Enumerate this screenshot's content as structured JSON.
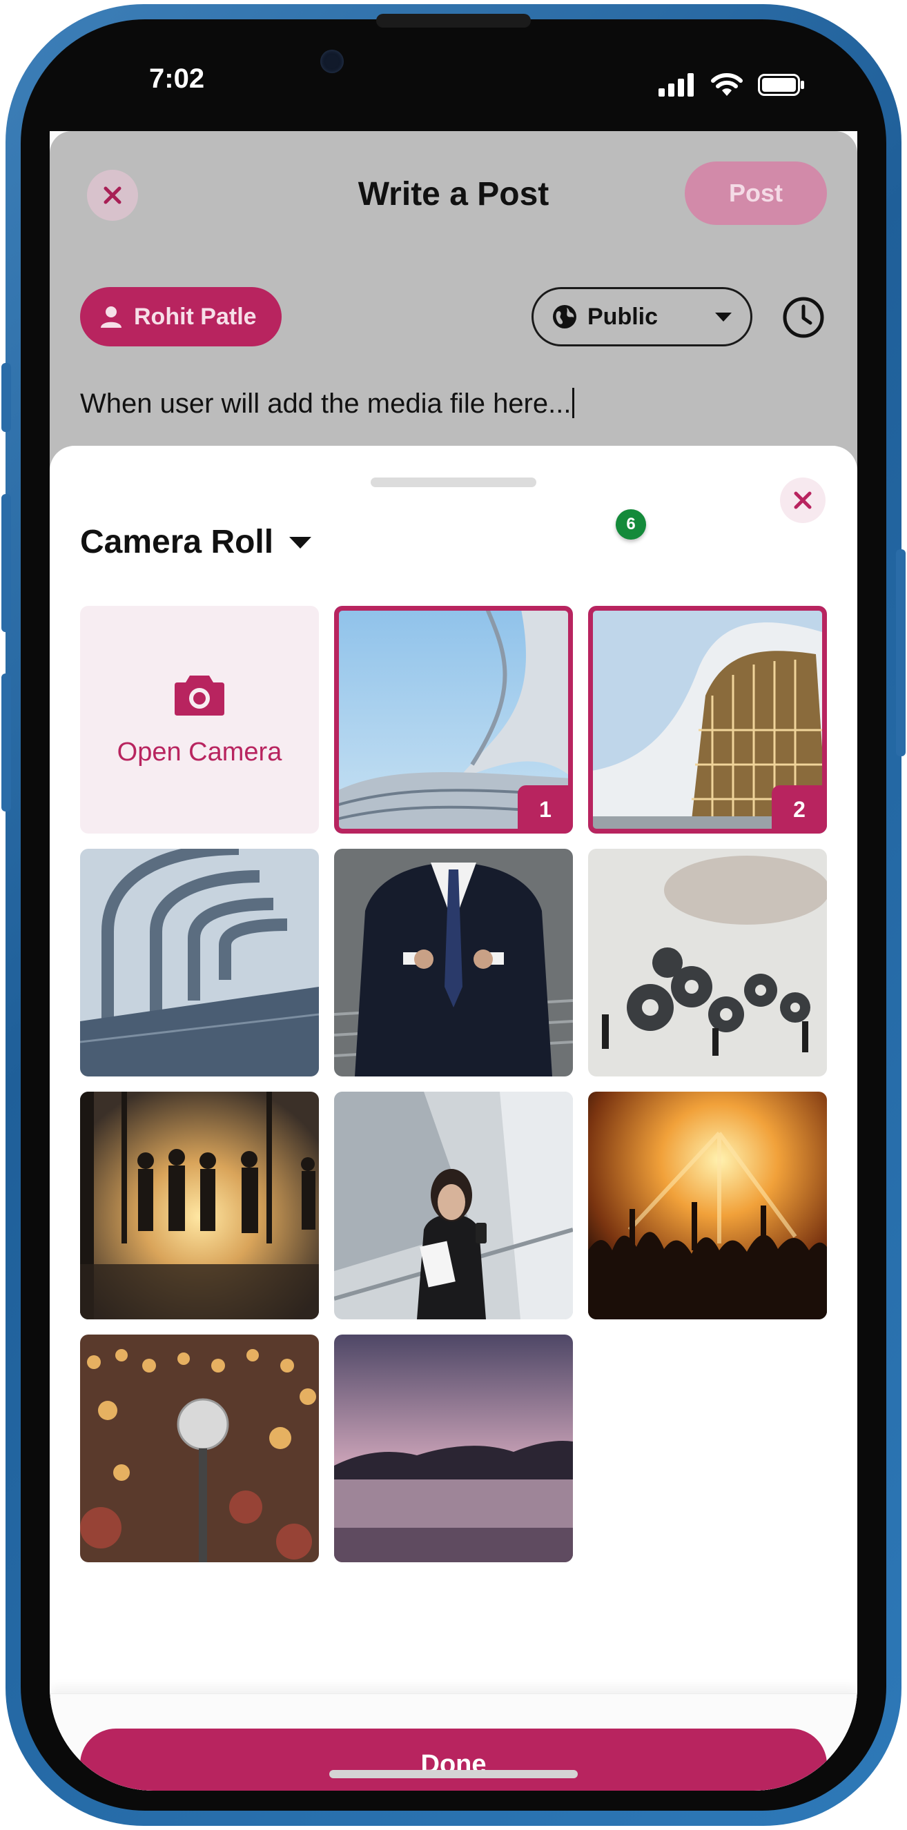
{
  "status_bar": {
    "time": "7:02"
  },
  "header": {
    "title": "Write a Post",
    "post_label": "Post"
  },
  "compose": {
    "author_name": "Rohit Patle",
    "visibility": "Public",
    "body_text": "When user will add the media file here..."
  },
  "picker": {
    "album_title": "Camera Roll",
    "selected_count_badge": "6",
    "open_camera_label": "Open Camera",
    "photos": [
      {
        "subject": "white curved building facade",
        "selected": true,
        "selection_number": "1"
      },
      {
        "subject": "curved glass building",
        "selected": true,
        "selection_number": "2"
      },
      {
        "subject": "arched tunnel corridor",
        "selected": false
      },
      {
        "subject": "man in suit buttoning jacket",
        "selected": false
      },
      {
        "subject": "people with gears",
        "selected": false
      },
      {
        "subject": "business people silhouettes at sunset",
        "selected": false
      },
      {
        "subject": "woman with phone in office",
        "selected": false
      },
      {
        "subject": "concert crowd with lights",
        "selected": false
      },
      {
        "subject": "microphone with bokeh lights",
        "selected": false
      },
      {
        "subject": "purple dusk lake",
        "selected": false
      }
    ]
  },
  "footer": {
    "done_label": "Done"
  },
  "colors": {
    "accent": "#b8245f",
    "badge_green": "#148a3a",
    "compose_overlay": "#bcbcbc"
  }
}
